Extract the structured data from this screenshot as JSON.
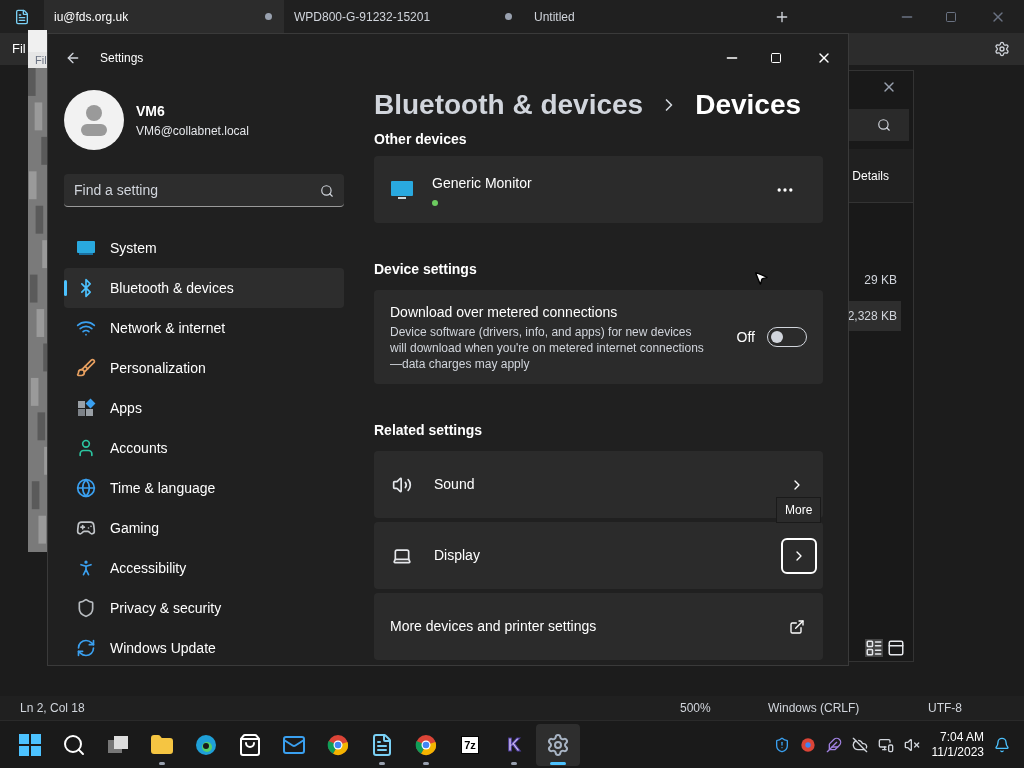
{
  "notepad": {
    "tabs": [
      {
        "label": "iu@fds.org.uk",
        "modified": true,
        "selected": true
      },
      {
        "label": "WPD800-G-91232-15201",
        "modified": true,
        "selected": false
      },
      {
        "label": "Untitled",
        "modified": false,
        "selected": false
      }
    ],
    "menu_partial": "Fil",
    "status_bar": [
      "Ln 2, Col 18",
      "500%",
      "Windows (CRLF)",
      "UTF-8"
    ]
  },
  "image_viewer": {
    "menu_partial": "Fil"
  },
  "explorer": {
    "details_label": "Details",
    "sizes": [
      {
        "text": "29 KB",
        "selected": false
      },
      {
        "text": "2,328 KB",
        "selected": true
      }
    ]
  },
  "settings": {
    "title": "Settings",
    "user": {
      "name": "VM6",
      "email": "VM6@collabnet.local"
    },
    "search": {
      "placeholder": "Find a setting"
    },
    "nav": [
      {
        "label": "System",
        "selected": false
      },
      {
        "label": "Bluetooth & devices",
        "selected": true
      },
      {
        "label": "Network & internet",
        "selected": false
      },
      {
        "label": "Personalization",
        "selected": false
      },
      {
        "label": "Apps",
        "selected": false
      },
      {
        "label": "Accounts",
        "selected": false
      },
      {
        "label": "Time & language",
        "selected": false
      },
      {
        "label": "Gaming",
        "selected": false
      },
      {
        "label": "Accessibility",
        "selected": false
      },
      {
        "label": "Privacy & security",
        "selected": false
      },
      {
        "label": "Windows Update",
        "selected": false
      }
    ],
    "breadcrumb": [
      "Bluetooth & devices",
      "Devices"
    ],
    "other_devices": {
      "heading": "Other devices",
      "devices": [
        {
          "name": "Generic Monitor"
        }
      ]
    },
    "device_settings": {
      "heading": "Device settings",
      "items": [
        {
          "title": "Download over metered connections",
          "description": "Device software (drivers, info, and apps) for new devices will download when you're on metered internet connections—data charges may apply",
          "state_label": "Off",
          "on": false
        }
      ]
    },
    "related": {
      "heading": "Related settings",
      "items": [
        {
          "label": "Sound",
          "kind": "nav",
          "focused": false
        },
        {
          "label": "Display",
          "kind": "nav",
          "focused": true
        },
        {
          "label": "More devices and printer settings",
          "kind": "external",
          "focused": false
        }
      ]
    },
    "tooltip": "More"
  },
  "taskbar": {
    "apps": [
      {
        "kind": "start",
        "running": false,
        "active": false
      },
      {
        "kind": "search",
        "running": false,
        "active": false
      },
      {
        "kind": "task-view",
        "running": false,
        "active": false
      },
      {
        "kind": "explorer",
        "running": true,
        "active": false
      },
      {
        "kind": "edge",
        "running": false,
        "active": false
      },
      {
        "kind": "store",
        "running": false,
        "active": false
      },
      {
        "kind": "mail",
        "running": false,
        "active": false
      },
      {
        "kind": "chrome",
        "running": false,
        "active": false
      },
      {
        "kind": "notepad",
        "running": true,
        "active": false
      },
      {
        "kind": "chrome",
        "running": true,
        "active": false
      },
      {
        "kind": "archiver",
        "label": "7z",
        "running": false,
        "active": false
      },
      {
        "kind": "letter-app",
        "label": "K",
        "running": true,
        "active": false
      },
      {
        "kind": "settings",
        "running": true,
        "active": true
      }
    ],
    "time": "7:04 AM",
    "date": "11/1/2023"
  }
}
